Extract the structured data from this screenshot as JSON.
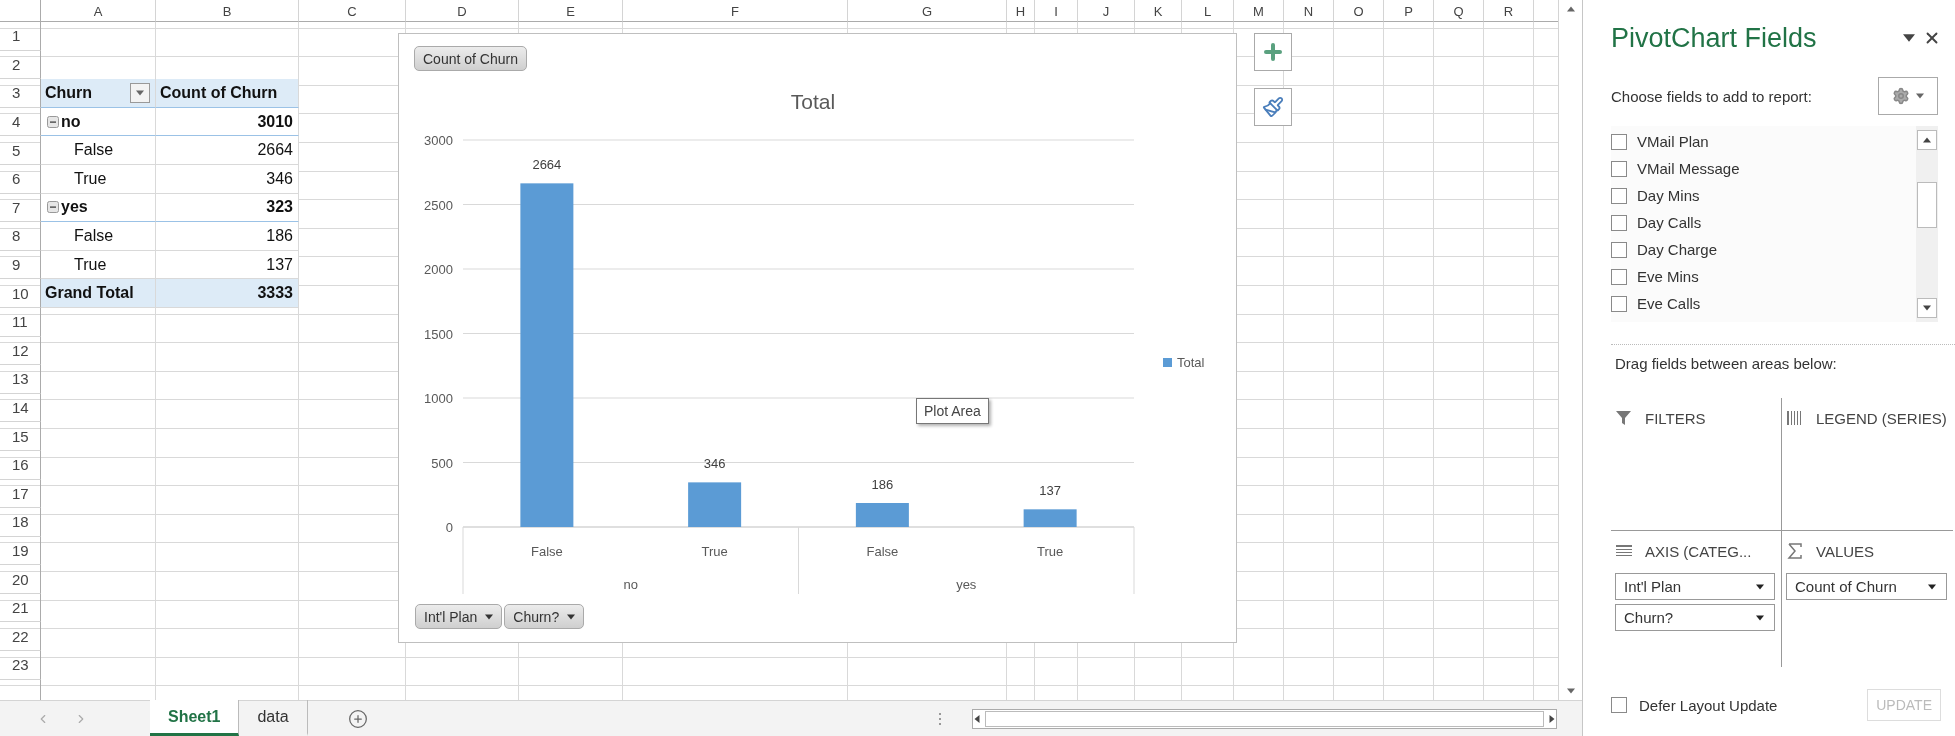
{
  "sheet": {
    "columns": [
      "A",
      "B",
      "C",
      "D",
      "E",
      "F",
      "G",
      "H",
      "I",
      "J",
      "K",
      "L",
      "M",
      "N",
      "O",
      "P",
      "Q",
      "R"
    ],
    "rows": [
      "1",
      "2",
      "3",
      "4",
      "5",
      "6",
      "7",
      "8",
      "9",
      "10",
      "11",
      "12",
      "13",
      "14",
      "15",
      "16",
      "17",
      "18",
      "19",
      "20",
      "21",
      "22",
      "23"
    ],
    "pivot_table": {
      "row_header": "Churn",
      "value_header": "Count of Churn",
      "groups": [
        {
          "label": "no",
          "value": "3010",
          "expanded": true,
          "children": [
            {
              "label": "False",
              "value": "2664"
            },
            {
              "label": "True",
              "value": "346"
            }
          ]
        },
        {
          "label": "yes",
          "value": "323",
          "expanded": true,
          "children": [
            {
              "label": "False",
              "value": "186"
            },
            {
              "label": "True",
              "value": "137"
            }
          ]
        }
      ],
      "grand_total": {
        "label": "Grand Total",
        "value": "3333"
      }
    }
  },
  "chart": {
    "value_field_button": "Count of Churn",
    "axis_field_buttons": [
      "Int'l Plan",
      "Churn?"
    ],
    "category_groups": [
      "no",
      "yes"
    ],
    "tooltip": "Plot Area",
    "chart_data": {
      "type": "bar",
      "title": "Total",
      "categories": [
        "False",
        "True",
        "False",
        "True"
      ],
      "series": [
        {
          "name": "Total",
          "color": "#5b9bd5",
          "values": [
            2664,
            346,
            186,
            137
          ]
        }
      ],
      "grid": true,
      "ylim": [
        0,
        3000
      ],
      "yticks": [
        0,
        500,
        1000,
        1500,
        2000,
        2500,
        3000
      ],
      "data_labels": true
    }
  },
  "sheet_tabs": [
    {
      "label": "Sheet1",
      "selected": true
    },
    {
      "label": "data",
      "selected": false
    }
  ],
  "field_panel": {
    "title": "PivotChart Fields",
    "prompt": "Choose fields to add to report:",
    "fields": [
      {
        "label": "VMail Plan",
        "checked": false
      },
      {
        "label": "VMail Message",
        "checked": false
      },
      {
        "label": "Day Mins",
        "checked": false
      },
      {
        "label": "Day Calls",
        "checked": false
      },
      {
        "label": "Day Charge",
        "checked": false
      },
      {
        "label": "Eve Mins",
        "checked": false
      },
      {
        "label": "Eve Calls",
        "checked": false
      }
    ],
    "areas_prompt": "Drag fields between areas below:",
    "areas": [
      {
        "kind": "filters",
        "label": "FILTERS"
      },
      {
        "kind": "legend",
        "label": "LEGEND (SERIES)"
      },
      {
        "kind": "axis",
        "label": "AXIS (CATEG...",
        "items": [
          "Int'l Plan",
          "Churn?"
        ]
      },
      {
        "kind": "values",
        "label": "VALUES",
        "items": [
          "Count of Churn"
        ]
      }
    ],
    "defer_update": {
      "label": "Defer Layout Update",
      "checked": false
    },
    "update_button": {
      "label": "UPDATE",
      "disabled": true
    }
  }
}
